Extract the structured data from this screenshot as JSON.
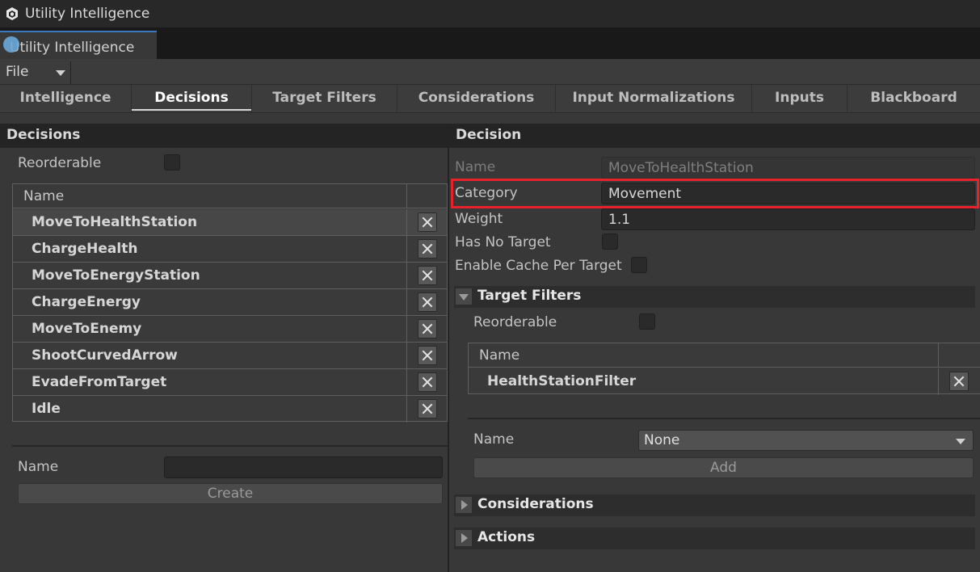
{
  "window": {
    "title": "Utility Intelligence",
    "tab_label": "Utility Intelligence"
  },
  "menu": {
    "file_label": "File"
  },
  "tabs": [
    {
      "label": "Intelligence",
      "active": false
    },
    {
      "label": "Decisions",
      "active": true
    },
    {
      "label": "Target Filters",
      "active": false
    },
    {
      "label": "Considerations",
      "active": false
    },
    {
      "label": "Input Normalizations",
      "active": false
    },
    {
      "label": "Inputs",
      "active": false
    },
    {
      "label": "Blackboard",
      "active": false
    }
  ],
  "decisions_panel": {
    "header": "Decisions",
    "reorderable_label": "Reorderable",
    "reorderable_checked": false,
    "column_name": "Name",
    "items": [
      {
        "name": "MoveToHealthStation",
        "selected": true
      },
      {
        "name": "ChargeHealth",
        "selected": false
      },
      {
        "name": "MoveToEnergyStation",
        "selected": false
      },
      {
        "name": "ChargeEnergy",
        "selected": false
      },
      {
        "name": "MoveToEnemy",
        "selected": false
      },
      {
        "name": "ShootCurvedArrow",
        "selected": false
      },
      {
        "name": "EvadeFromTarget",
        "selected": false
      },
      {
        "name": "Idle",
        "selected": false
      }
    ],
    "new_name_label": "Name",
    "new_name_value": "",
    "create_label": "Create"
  },
  "decision_panel": {
    "header": "Decision",
    "name_label": "Name",
    "name_value": "MoveToHealthStation",
    "category_label": "Category",
    "category_value": "Movement",
    "weight_label": "Weight",
    "weight_value": "1.1",
    "has_no_target_label": "Has No Target",
    "enable_cache_label": "Enable Cache Per Target",
    "target_filters": {
      "title": "Target Filters",
      "expanded": true,
      "reorderable_label": "Reorderable",
      "column_name": "Name",
      "items": [
        {
          "name": "HealthStationFilter"
        }
      ],
      "name_label": "Name",
      "dropdown_value": "None",
      "add_label": "Add"
    },
    "considerations_title": "Considerations",
    "actions_title": "Actions"
  },
  "colors": {
    "highlight": "#e8212a",
    "accent": "#3a79bb"
  }
}
